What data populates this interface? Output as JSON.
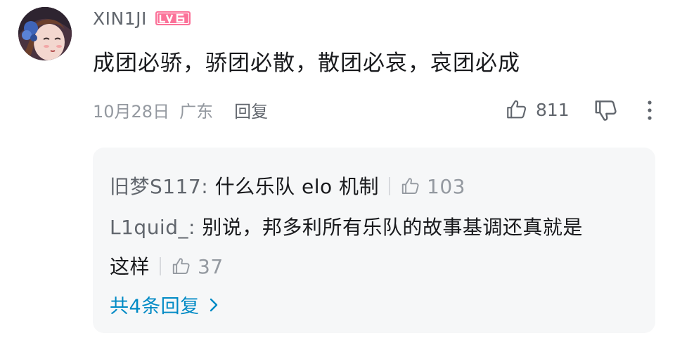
{
  "comment": {
    "username": "XIN1JI",
    "level_badge": "LV6",
    "text": "成团必骄，骄团必散，散团必哀，哀团必成",
    "date": "10月28日",
    "location": "广东",
    "reply_label": "回复",
    "like_count": "811",
    "colors": {
      "level_badge": "#fb7299",
      "link": "#008ac5",
      "muted": "#9499a0"
    }
  },
  "replies": {
    "items": [
      {
        "author": "旧梦S117",
        "separator": ": ",
        "text": "什么乐队 elo 机制",
        "like_count": "103"
      },
      {
        "author": "L1quid_",
        "separator": ": ",
        "text_line1": "别说，邦多利所有乐队的故事基调还真就是",
        "text_line2": "这样",
        "like_count": "37"
      }
    ],
    "view_more_label": "共4条回复"
  },
  "icons": {
    "like": "thumbs-up-icon",
    "dislike": "thumbs-down-icon",
    "more": "more-vertical-icon",
    "chevron": "chevron-right-icon"
  }
}
